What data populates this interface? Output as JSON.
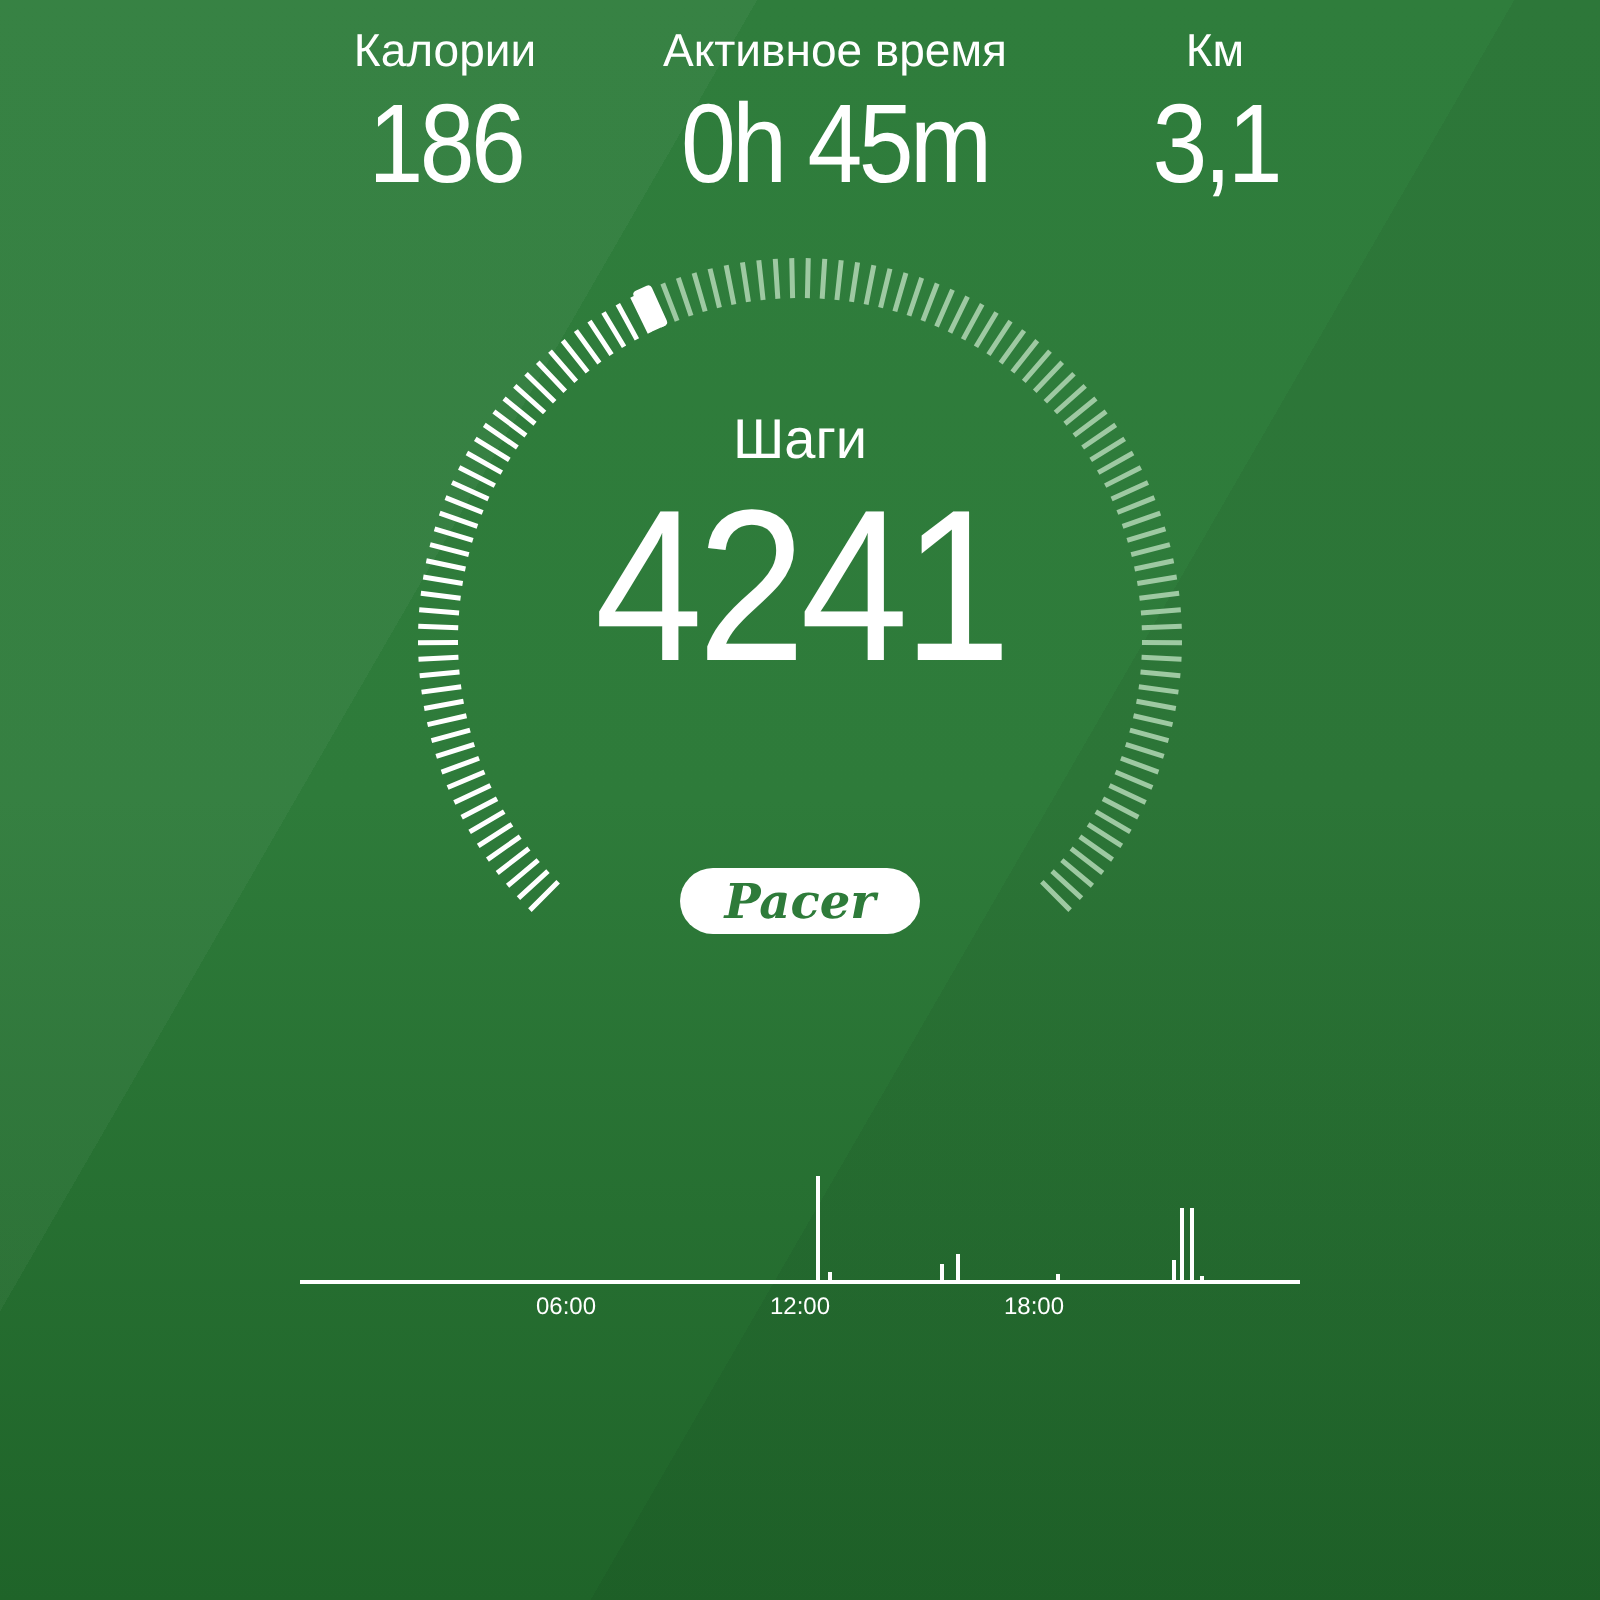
{
  "stats": [
    {
      "label": "Калории",
      "value": "186"
    },
    {
      "label": "Активное время",
      "value": "0h 45m"
    },
    {
      "label": "Км",
      "value": "3,1"
    }
  ],
  "gauge": {
    "label": "Шаги",
    "value": "4241"
  },
  "brand": {
    "text": "Pacer"
  },
  "activity_chart": {
    "x_labels": [
      "06:00",
      "12:00",
      "18:00"
    ]
  }
}
